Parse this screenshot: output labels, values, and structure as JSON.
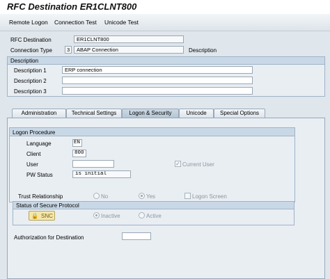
{
  "title": "RFC Destination ER1CLNT800",
  "toolbar": {
    "remote_logon": "Remote Logon",
    "connection_test": "Connection Test",
    "unicode_test": "Unicode Test"
  },
  "header": {
    "rfc_destination_label": "RFC Destination",
    "rfc_destination_value": "ER1CLNT800",
    "connection_type_label": "Connection Type",
    "connection_type_code": "3",
    "connection_type_text": "ABAP Connection",
    "description_label": "Description"
  },
  "description_group": {
    "heading": "Description",
    "rows": [
      {
        "label": "Description 1",
        "value": "ERP connection"
      },
      {
        "label": "Description 2",
        "value": ""
      },
      {
        "label": "Description 3",
        "value": ""
      }
    ]
  },
  "tabs": [
    {
      "label": "Administration",
      "active": false
    },
    {
      "label": "Technical Settings",
      "active": false
    },
    {
      "label": "Logon & Security",
      "active": true
    },
    {
      "label": "Unicode",
      "active": false
    },
    {
      "label": "Special Options",
      "active": false
    }
  ],
  "logon_procedure": {
    "heading": "Logon Procedure",
    "language_label": "Language",
    "language_value": "EN",
    "client_label": "Client",
    "client_value": "800",
    "user_label": "User",
    "user_value": "",
    "current_user_label": "Current User",
    "current_user_checked": true,
    "pw_status_label": "PW Status",
    "pw_status_value": "is initial"
  },
  "trust": {
    "label": "Trust Relationship",
    "no_label": "No",
    "yes_label": "Yes",
    "logon_screen_label": "Logon Screen",
    "selected": "Yes"
  },
  "secure_protocol": {
    "heading": "Status of Secure Protocol",
    "snc_button": "SNC",
    "inactive_label": "Inactive",
    "active_label": "Active",
    "selected": "Inactive"
  },
  "authorization": {
    "label": "Authorization for Destination",
    "value": ""
  },
  "colors": {
    "background": "#dfe6ec",
    "group_header": "#c9d8e6",
    "active_tab": "#b3c4d4",
    "snc_button": "#f5e7a8"
  }
}
